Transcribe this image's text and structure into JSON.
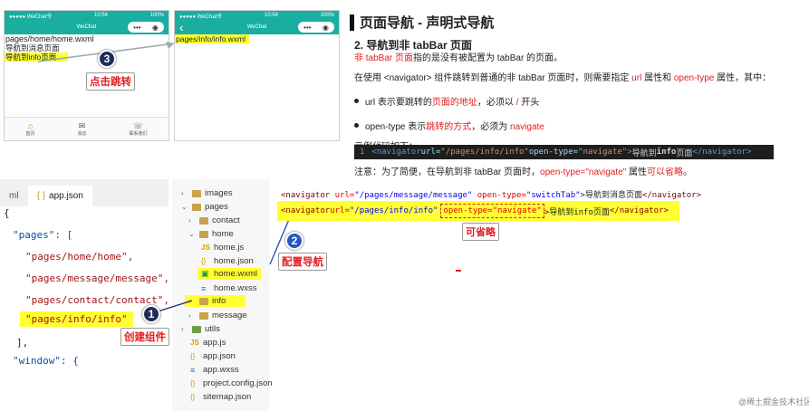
{
  "phone1": {
    "status_left": "●●●●● WeChat令",
    "status_time": "10:54",
    "status_right": "100%",
    "nav_title": "WeChat",
    "capsule_dots": "•••",
    "capsule_ring": "◉",
    "lines": [
      "pages/home/home.wxml",
      "导航到消息页面",
      "导航到info页面"
    ],
    "tabs": [
      {
        "icon": "⌂",
        "label": "首页"
      },
      {
        "icon": "✉",
        "label": "消息"
      },
      {
        "icon": "☏",
        "label": "联系我们"
      }
    ]
  },
  "phone2": {
    "status_left": "●●●●● WeChat令",
    "status_time": "10:54",
    "status_right": "100%",
    "nav_title": "WeChat",
    "back": "‹",
    "line": "pages/info/info.wxml"
  },
  "badges": {
    "one": "1",
    "two": "2",
    "three": "3"
  },
  "callouts": {
    "click": "点击跳转",
    "config": "配置导航",
    "create": "创建组件",
    "omit": "可省略"
  },
  "doc": {
    "title": "页面导航 - 声明式导航",
    "subtitle": "2. 导航到非 tabBar 页面",
    "p1_red": "非 tabBar 页面",
    "p1_rest": "指的是没有被配置为 tabBar 的页面。",
    "p2_a": "在使用 <navigator> 组件跳转到普通的非 tabBar 页面时，则需要指定 ",
    "p2_url": "url",
    "p2_b": " 属性和 ",
    "p2_ot": "open-type",
    "p2_c": " 属性，其中：",
    "b1_a": "url 表示要跳转的",
    "b1_red": "页面的地址",
    "b1_b": "，必须以 ",
    "b1_slash": "/",
    "b1_c": " 开头",
    "b2_a": "open-type 表示",
    "b2_red": "跳转的方式",
    "b2_b": "，必须为 ",
    "b2_nav": "navigate",
    "example": "示例代码如下：",
    "note_a": "注意：为了简便，在导航到非 tabBar 页面时，",
    "note_red1": "open-type=\"navigate\"",
    "note_b": " 属性",
    "note_red2": "可以省略",
    "note_c": "。"
  },
  "code_example": {
    "ln": "1",
    "open": "<navigator",
    "url_attr": " url=",
    "url_val": "\"/pages/info/info\"",
    "ot_attr": " open-type=",
    "ot_val": "\"navigate\"",
    "gt": ">",
    "text_a": "导航到",
    "text_b": "info",
    "text_c": "页面",
    "close": "</navigator>"
  },
  "editor": {
    "tab_left": "ml",
    "tab_active": "app.json",
    "tab_icon": "{ }",
    "lines": [
      "{",
      "\"pages\": [",
      "\"pages/home/home\",",
      "\"pages/message/message\",",
      "\"pages/contact/contact\",",
      "\"pages/info/info\"",
      "],",
      "\"window\": {"
    ]
  },
  "explorer": {
    "items": [
      "images",
      "pages",
      "contact",
      "home",
      "home.js",
      "home.json",
      "home.wxml",
      "home.wxss",
      "info",
      "message",
      "utils",
      "app.js",
      "app.json",
      "app.wxss",
      "project.config.json",
      "sitemap.json"
    ]
  },
  "code_lines": {
    "l1_open": "<navigator",
    "l1_url_attr": " url=",
    "l1_url_val": "\"/pages/message/message\"",
    "l1_ot_attr": " open-type=",
    "l1_ot_val": "\"switchTab\"",
    "l1_text": ">导航到消息页面",
    "l1_close": "</navigator>",
    "l2_open": "<navigator",
    "l2_url_attr": " url=",
    "l2_url_val": "\"/pages/info/info\"",
    "l2_ot": "open-type=\"navigate\"",
    "l2_text": ">导航到info页面",
    "l2_close": "</navigator>"
  },
  "watermark": "@稀土掘金技术社区",
  "colors": {
    "wechat_teal": "#1aaea0",
    "highlight": "#ffff33",
    "accent_red": "#e02020",
    "badge_blue": "#2b55c4"
  }
}
